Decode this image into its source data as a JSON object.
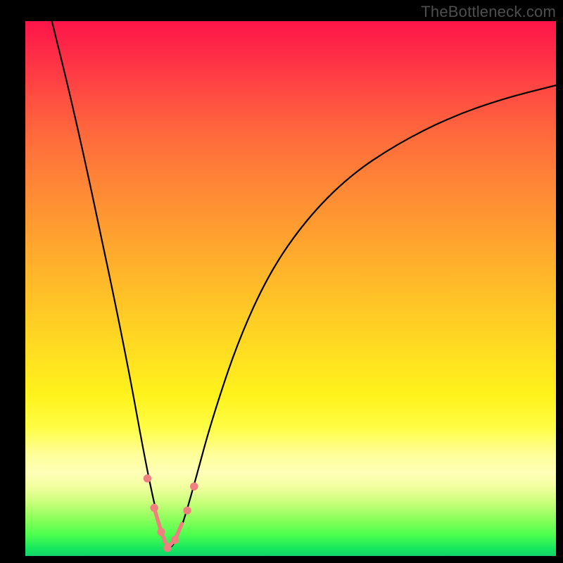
{
  "watermark": "TheBottleneck.com",
  "chart_data": {
    "type": "line",
    "title": "",
    "xlabel": "",
    "ylabel": "",
    "xlim": [
      0,
      100
    ],
    "ylim": [
      0,
      100
    ],
    "notes": "Bottleneck-style V curve: x is an implicit performance ratio axis (0–100), y is bottleneck severity (0 = none, 100 = severe). Minimum around x ≈ 27. Background is a vertical heat gradient from red (100) to green (0). Salmon dots mark sampled points near the minimum.",
    "background_gradient": {
      "stops": [
        {
          "pos": 0,
          "color": "#fe1548"
        },
        {
          "pos": 6,
          "color": "#fe2c47"
        },
        {
          "pos": 14,
          "color": "#ff4d42"
        },
        {
          "pos": 22,
          "color": "#ff6c3c"
        },
        {
          "pos": 32,
          "color": "#ff8a35"
        },
        {
          "pos": 42,
          "color": "#ffa62e"
        },
        {
          "pos": 52,
          "color": "#ffc327"
        },
        {
          "pos": 62,
          "color": "#ffde21"
        },
        {
          "pos": 70,
          "color": "#fff31c"
        },
        {
          "pos": 76,
          "color": "#fffd45"
        },
        {
          "pos": 81,
          "color": "#ffff9a"
        },
        {
          "pos": 84.5,
          "color": "#ffffb8"
        },
        {
          "pos": 87,
          "color": "#f3ffa0"
        },
        {
          "pos": 90,
          "color": "#c9ff7a"
        },
        {
          "pos": 93,
          "color": "#8dff5c"
        },
        {
          "pos": 96,
          "color": "#4dff4e"
        },
        {
          "pos": 98.5,
          "color": "#18e85e"
        },
        {
          "pos": 100,
          "color": "#11d46a"
        }
      ]
    },
    "series": [
      {
        "name": "bottleneck-curve",
        "x": [
          5,
          8,
          11,
          14,
          17,
          20,
          22,
          24,
          25.5,
          27,
          28.5,
          30,
          32,
          35,
          40,
          46,
          53,
          61,
          70,
          80,
          90,
          100
        ],
        "y": [
          100,
          88,
          75,
          61,
          47,
          32,
          21,
          11,
          5,
          1,
          3,
          7,
          14,
          25,
          40,
          53,
          63,
          71,
          77,
          82,
          85.5,
          88
        ]
      }
    ],
    "marker_points": {
      "name": "near-minimum-samples",
      "color": "#f08080",
      "x": [
        23.0,
        24.3,
        25.6,
        26.8,
        28.2,
        30.5,
        31.8
      ],
      "y": [
        14.5,
        9.0,
        4.5,
        1.5,
        3.0,
        8.5,
        13.0
      ]
    },
    "marker_segment": {
      "color": "#f08080",
      "x": [
        24.3,
        25.6,
        26.8,
        28.2,
        29.5
      ],
      "y": [
        9.0,
        4.5,
        1.5,
        3.0,
        6.0
      ]
    }
  }
}
